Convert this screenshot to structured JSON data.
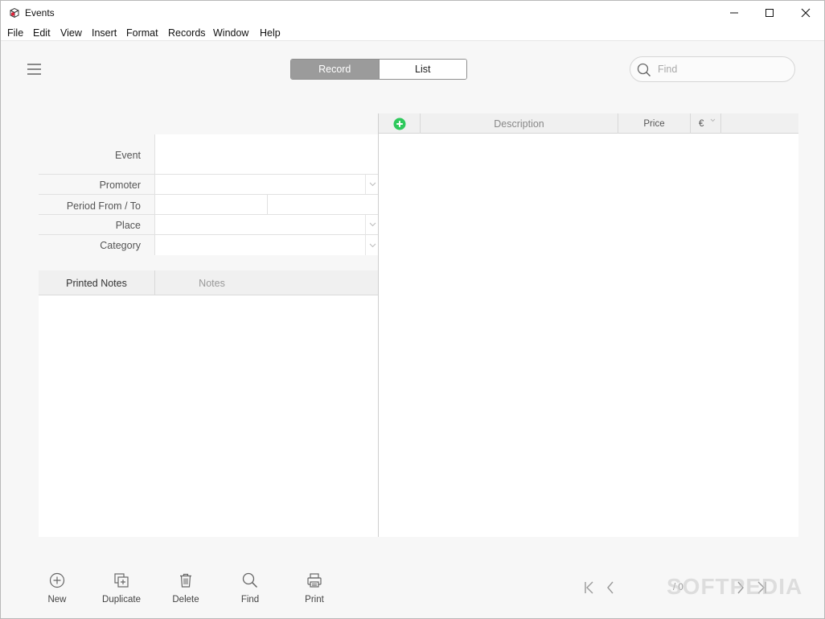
{
  "window": {
    "title": "Events"
  },
  "menubar": [
    "File",
    "Edit",
    "View",
    "Insert",
    "Format",
    "Records",
    "Window",
    "Help"
  ],
  "view_switch": {
    "record_label": "Record",
    "list_label": "List",
    "selected": "Record"
  },
  "search": {
    "placeholder": "Find",
    "value": ""
  },
  "form": {
    "event_label": "Event",
    "promoter_label": "Promoter",
    "period_label": "Period From / To",
    "place_label": "Place",
    "category_label": "Category"
  },
  "notes": {
    "printed_notes_label": "Printed Notes",
    "notes_label": "Notes",
    "active": "Printed Notes"
  },
  "items_table": {
    "columns": {
      "description": "Description",
      "price": "Price",
      "currency": "€"
    },
    "rows": []
  },
  "bottom_toolbar": {
    "new_label": "New",
    "duplicate_label": "Duplicate",
    "delete_label": "Delete",
    "find_label": "Find",
    "print_label": "Print"
  },
  "record_nav": {
    "position": "/ 0"
  },
  "watermark": "SOFTPEDIA",
  "colors": {
    "add_green": "#2ec95c",
    "segment_active": "#9b9b9b"
  },
  "icons": [
    "app-icon",
    "minimize-icon",
    "maximize-icon",
    "close-icon",
    "menu-icon",
    "search-icon",
    "add-row-icon",
    "chevron-down-icon",
    "new-icon",
    "duplicate-icon",
    "delete-icon",
    "find-icon",
    "print-icon",
    "first-record-icon",
    "previous-record-icon",
    "next-record-icon",
    "last-record-icon"
  ]
}
